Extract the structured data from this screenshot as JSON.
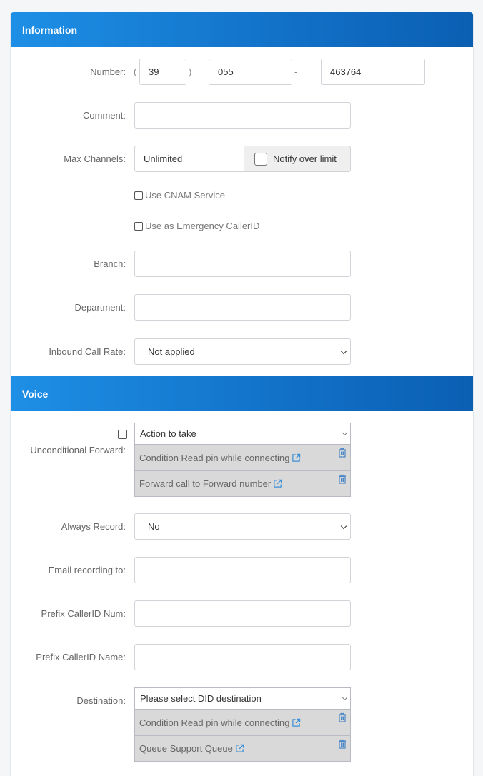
{
  "information": {
    "header": "Information",
    "number_label": "Number:",
    "number_paren_open": "(",
    "number_paren_close": ")",
    "number_dash": "-",
    "number_area": "39",
    "number_prefix": "055",
    "number_line": "463764",
    "comment_label": "Comment:",
    "comment_value": "",
    "max_channels_label": "Max Channels:",
    "max_channels_value": "Unlimited",
    "notify_over_limit": "Notify over limit",
    "use_cnam": "Use CNAM Service",
    "use_emergency": "Use as Emergency CallerID",
    "branch_label": "Branch:",
    "branch_value": "",
    "department_label": "Department:",
    "department_value": "",
    "inbound_rate_label": "Inbound Call Rate:",
    "inbound_rate_value": "Not applied"
  },
  "voice": {
    "header": "Voice",
    "uncond_label": "Unconditional Forward:",
    "uncond_select": "Action to take",
    "uncond_items": [
      "Condition Read pin while connecting",
      "Forward call to Forward number"
    ],
    "always_record_label": "Always Record:",
    "always_record_value": "No",
    "email_recording_label": "Email recording to:",
    "email_recording_value": "",
    "prefix_num_label": "Prefix CallerID Num:",
    "prefix_num_value": "",
    "prefix_name_label": "Prefix CallerID Name:",
    "prefix_name_value": "",
    "destination_label": "Destination:",
    "destination_select": "Please select DID destination",
    "destination_items": [
      "Condition Read pin while connecting",
      "Queue Support Queue"
    ]
  },
  "colors": {
    "header_gradient_start": "#1e8fe6",
    "header_gradient_end": "#0b5fb3",
    "link_icon": "#3a8fd8",
    "trash_icon": "#4a86c5"
  },
  "icons": [
    "external-link-icon",
    "trash-icon",
    "chevron-down-icon"
  ]
}
